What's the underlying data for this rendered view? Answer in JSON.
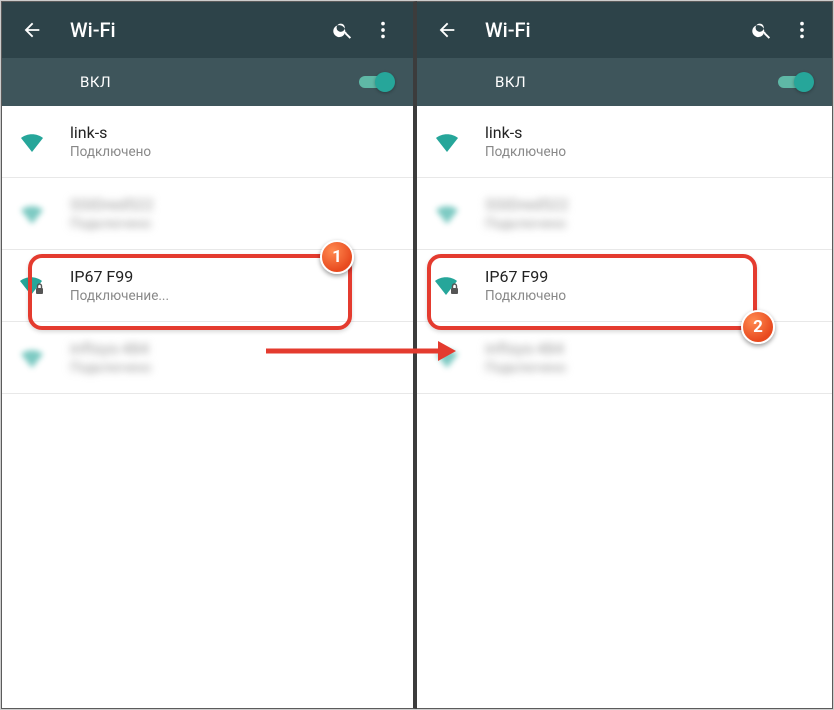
{
  "colors": {
    "accent": "#26a69a",
    "toolbar": "#2d4349",
    "highlight": "#e43b2f"
  },
  "screen1": {
    "title": "Wi-Fi",
    "toggle_label": "ВКЛ",
    "networks": [
      {
        "name": "link-s",
        "status": "Подключено",
        "blurred": false,
        "locked": false
      },
      {
        "name": "SSIDred522",
        "status": "Подключено",
        "blurred": true,
        "locked": true
      },
      {
        "name": "IP67 F99",
        "status": "Подключение...",
        "blurred": false,
        "locked": true
      },
      {
        "name": "inftsys-484",
        "status": "Подключено",
        "blurred": true,
        "locked": false
      }
    ],
    "step_badge": "1"
  },
  "screen2": {
    "title": "Wi-Fi",
    "toggle_label": "ВКЛ",
    "networks": [
      {
        "name": "link-s",
        "status": "Подключено",
        "blurred": false,
        "locked": false
      },
      {
        "name": "SSIDred522",
        "status": "Подключено",
        "blurred": true,
        "locked": true
      },
      {
        "name": "IP67 F99",
        "status": "Подключено",
        "blurred": false,
        "locked": true
      },
      {
        "name": "inftsys-484",
        "status": "Подключено",
        "blurred": true,
        "locked": false
      }
    ],
    "step_badge": "2"
  }
}
